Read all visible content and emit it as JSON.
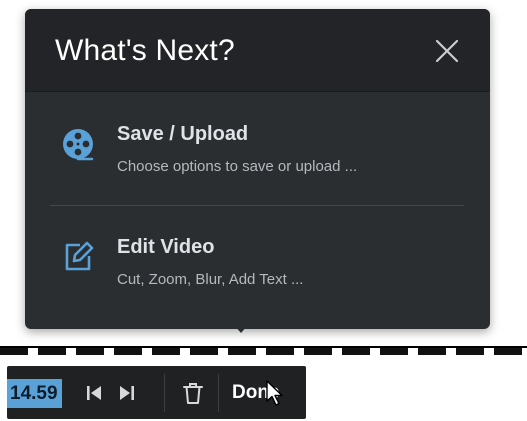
{
  "popup": {
    "title": "What's Next?",
    "options": [
      {
        "title": "Save / Upload",
        "description": "Choose options to save or upload ...",
        "icon": "film-reel-icon"
      },
      {
        "title": "Edit Video",
        "description": "Cut, Zoom, Blur, Add Text ...",
        "icon": "edit-icon"
      }
    ],
    "close_icon": "close-icon"
  },
  "toolbar": {
    "time_value": "14.59",
    "prev_icon": "skip-to-start-icon",
    "next_icon": "skip-to-end-icon",
    "delete_icon": "trash-icon",
    "done_label": "Done"
  },
  "colors": {
    "popup_bg": "#2b2e31",
    "accent": "#5aa1d8"
  }
}
